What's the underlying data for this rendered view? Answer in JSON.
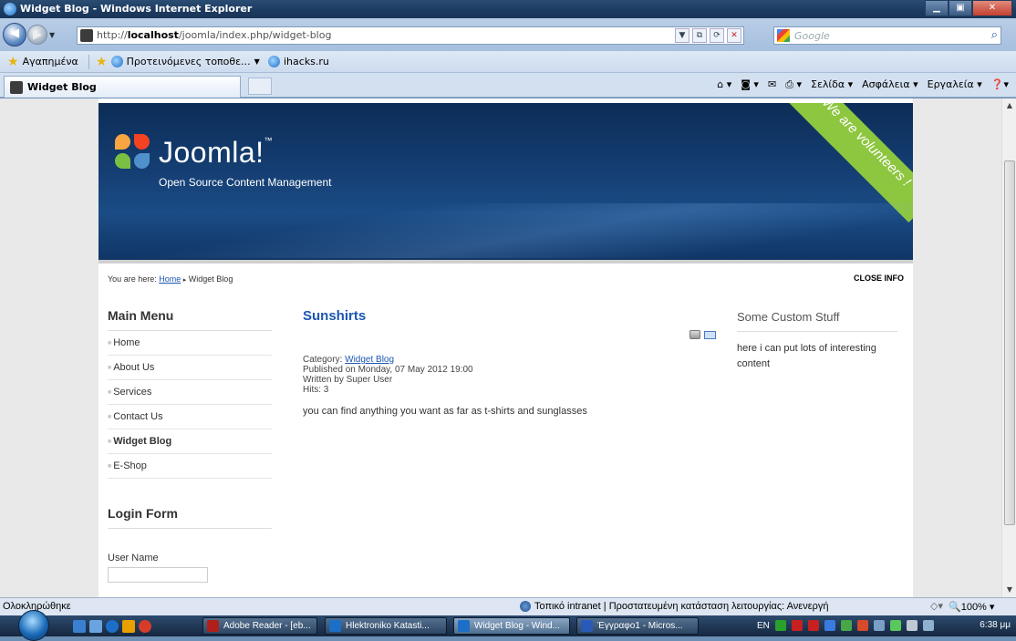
{
  "window": {
    "title": "Widget Blog - Windows Internet Explorer"
  },
  "address": {
    "url_prefix": "http://",
    "url_host": "localhost",
    "url_path": "/joomla/index.php/widget-blog",
    "search_placeholder": "Google"
  },
  "favorites": {
    "label": "Αγαπημένα",
    "suggested": "Προτεινόμενες τοποθε...",
    "link": "ihacks.ru"
  },
  "tab": {
    "title": "Widget Blog"
  },
  "commands": {
    "page": "Σελίδα",
    "safety": "Ασφάλεια",
    "tools": "Εργαλεία"
  },
  "site": {
    "brand": "Joomla!",
    "brand_tm": "™",
    "tagline": "Open Source Content Management",
    "ribbon": "We are volunteers !",
    "breadcrumb_prefix": "You are here:",
    "breadcrumb_home": "Home",
    "breadcrumb_current": "Widget Blog",
    "close_info": "CLOSE INFO"
  },
  "main_menu": {
    "title": "Main Menu",
    "items": [
      {
        "label": "Home",
        "active": false
      },
      {
        "label": "About Us",
        "active": false
      },
      {
        "label": "Services",
        "active": false
      },
      {
        "label": "Contact Us",
        "active": false
      },
      {
        "label": "Widget Blog",
        "active": true
      },
      {
        "label": "E-Shop",
        "active": false
      }
    ]
  },
  "login": {
    "title": "Login Form",
    "username_label": "User Name",
    "username_value": ""
  },
  "article": {
    "title": "Sunshirts",
    "category_label": "Category:",
    "category_link": "Widget Blog",
    "published": "Published on Monday, 07 May 2012 19:00",
    "author": "Written by Super User",
    "hits": "Hits: 3",
    "body": "you can find anything you want as far as t-shirts and sunglasses"
  },
  "custom": {
    "title": "Some Custom Stuff",
    "body": "here i can put lots of interesting content"
  },
  "status": {
    "left": "Ολοκληρώθηκε",
    "zone": "Τοπικό intranet | Προστατευμένη κατάσταση λειτουργίας: Ανενεργή",
    "zoom": "100%"
  },
  "taskbar": {
    "tasks": [
      {
        "label": "Adobe Reader - [eb...",
        "active": false,
        "color": "#b0201a"
      },
      {
        "label": "Hlektroniko Katasti...",
        "active": false,
        "color": "#1c6fc6"
      },
      {
        "label": "Widget Blog - Wind...",
        "active": true,
        "color": "#1c6fc6"
      },
      {
        "label": "Έγγραφο1 - Micros...",
        "active": false,
        "color": "#2a5ab8"
      }
    ],
    "lang": "EN",
    "clock": "6:38 μμ"
  }
}
